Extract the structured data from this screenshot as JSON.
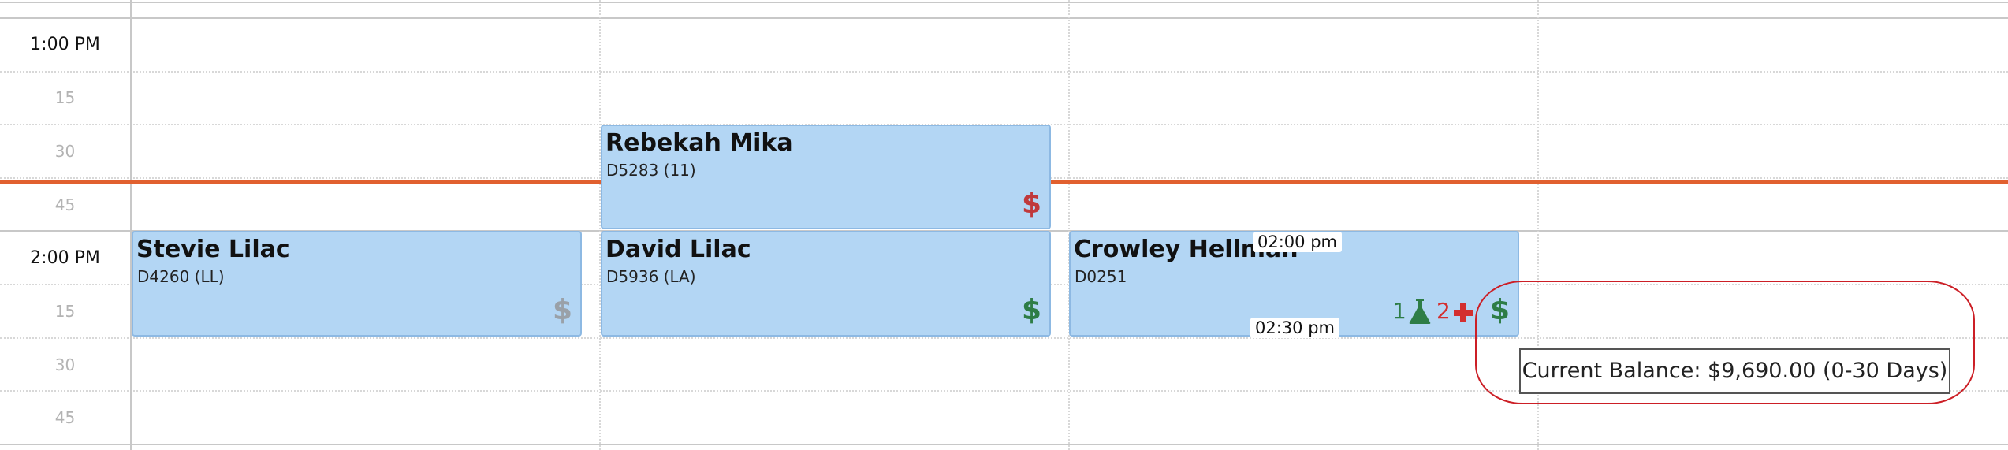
{
  "time_gutter": {
    "hour_1pm": "1:00 PM",
    "min_1_15": "15",
    "min_1_30": "30",
    "min_1_45": "45",
    "hour_2pm": "2:00 PM",
    "min_2_15": "15",
    "min_2_30": "30",
    "min_2_45": "45"
  },
  "appointments": [
    {
      "name": "Rebekah Mika",
      "code": "D5283 (11)",
      "balance_icon": "dollar-icon",
      "balance_color": "#c0393b"
    },
    {
      "name": "Stevie Lilac",
      "code": "D4260 (LL)",
      "balance_icon": "dollar-icon",
      "balance_color": "#9aa1a8"
    },
    {
      "name": "David Lilac",
      "code": "D5936 (LA)",
      "balance_icon": "dollar-icon",
      "balance_color": "#2e7d46"
    },
    {
      "name": "Crowley Hellman",
      "code": "D0251",
      "balance_icon": "dollar-icon",
      "balance_color": "#2e7d46",
      "start_time": "02:00 pm",
      "end_time": "02:30 pm",
      "lab_count": "1",
      "lab_icon": "flask-icon",
      "lab_color": "#2e7d46",
      "medical_count": "2",
      "medical_icon": "medical-cross-icon",
      "medical_color": "#d32f2f"
    }
  ],
  "tooltip": {
    "text": "Current Balance: $9,690.00 (0-30 Days)"
  },
  "colors": {
    "now_line": "#e1602f",
    "appointment_bg": "#b3d6f4",
    "highlight_ring": "#cc1f26"
  }
}
